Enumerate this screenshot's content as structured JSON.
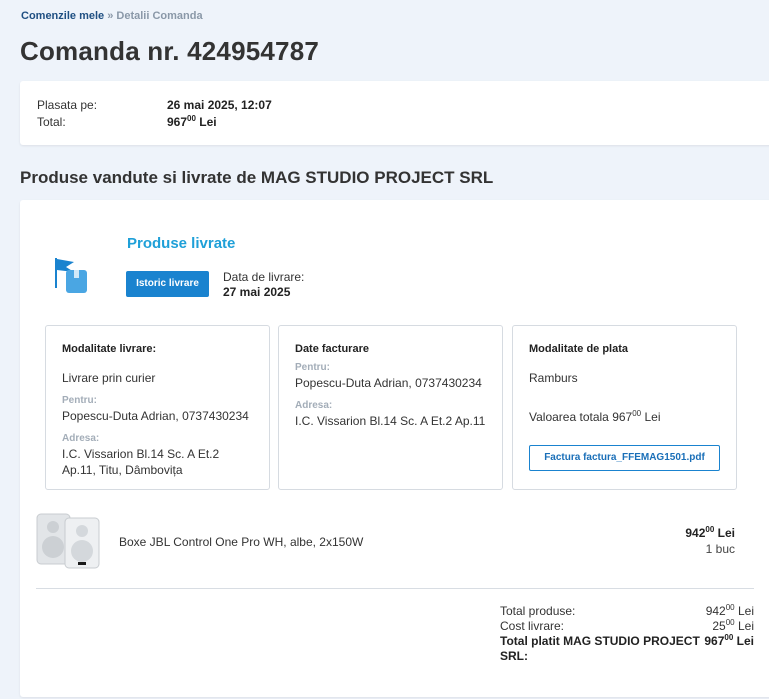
{
  "breadcrumb": {
    "link": "Comenzile mele",
    "separator": "»",
    "current": "Detalii Comanda"
  },
  "page_title": "Comanda nr. 424954787",
  "summary": {
    "placed_label": "Plasata pe:",
    "placed_value": "26 mai 2025, 12:07",
    "total_label": "Total:",
    "total_int": "967",
    "total_dec": "00",
    "total_currency": "Lei"
  },
  "section_title": "Produse vandute si livrate de MAG STUDIO PROJECT SRL",
  "status": {
    "icon": "delivered-flag-box-icon",
    "title": "Produse livrate",
    "history_button": "Istoric livrare",
    "delivery_date_label": "Data de livrare:",
    "delivery_date_value": "27 mai 2025"
  },
  "delivery_box": {
    "title": "Modalitate livrare:",
    "method": "Livrare prin curier",
    "for_label": "Pentru:",
    "for_value": "Popescu-Duta Adrian, 0737430234",
    "address_label": "Adresa:",
    "address_value": "I.C. Vissarion Bl.14 Sc. A Et.2 Ap.11, Titu, Dâmbovița"
  },
  "billing_box": {
    "title": "Date facturare",
    "for_label": "Pentru:",
    "for_value": "Popescu-Duta Adrian, 0737430234",
    "address_label": "Adresa:",
    "address_value": "I.C. Vissarion Bl.14 Sc. A Et.2 Ap.11"
  },
  "payment_box": {
    "title": "Modalitate de plata",
    "method": "Ramburs",
    "total_label": "Valoarea totala",
    "total_int": "967",
    "total_dec": "00",
    "total_currency": "Lei",
    "invoice_button": "Factura factura_FFEMAG1501.pdf"
  },
  "product": {
    "image_icon": "jbl-speakers-image",
    "name": "Boxe JBL Control One Pro WH, albe, 2x150W",
    "price_int": "942",
    "price_dec": "00",
    "currency": "Lei",
    "quantity": "1 buc"
  },
  "totals": {
    "products_label": "Total produse:",
    "products_int": "942",
    "products_dec": "00",
    "shipping_label": "Cost livrare:",
    "shipping_int": "25",
    "shipping_dec": "00",
    "paid_label": "Total platit MAG STUDIO PROJECT SRL:",
    "paid_int": "967",
    "paid_dec": "00",
    "currency": "Lei"
  },
  "colors": {
    "accent": "#1a83cf",
    "status_title": "#1fa0d8",
    "background": "#eef3fa"
  }
}
